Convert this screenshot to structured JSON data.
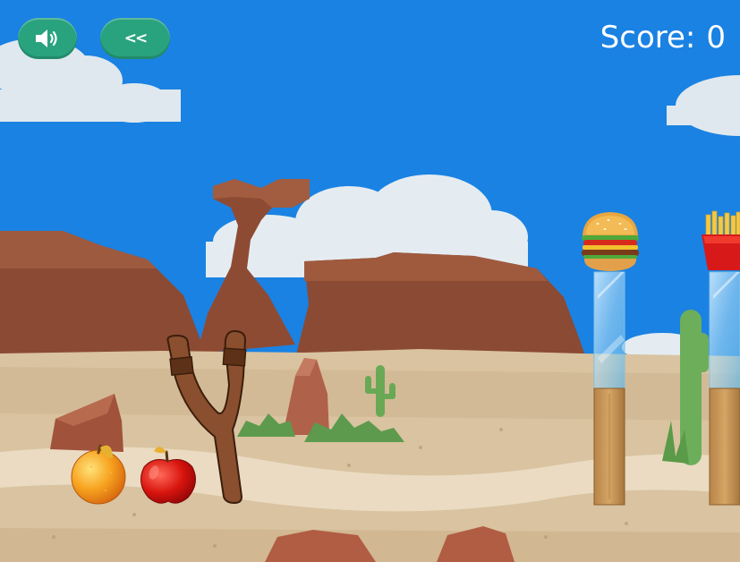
{
  "hud": {
    "score_label": "Score:",
    "score_value": "0",
    "sound_button": {
      "icon": "speaker-icon",
      "state": "on"
    },
    "back_button": {
      "icon": "double-chevron-left-icon",
      "glyph": "<<"
    }
  },
  "scene": {
    "setting": "desert",
    "ammo": [
      {
        "type": "orange",
        "icon": "orange-fruit"
      },
      {
        "type": "apple",
        "icon": "red-apple"
      }
    ],
    "targets": [
      {
        "type": "burger",
        "icon": "hamburger"
      },
      {
        "type": "fries",
        "icon": "french-fries"
      }
    ]
  },
  "colors": {
    "sky": "#1a82e2",
    "button": "#29a37d",
    "rock": "#8a4a33",
    "ground": "#d8c19c"
  }
}
